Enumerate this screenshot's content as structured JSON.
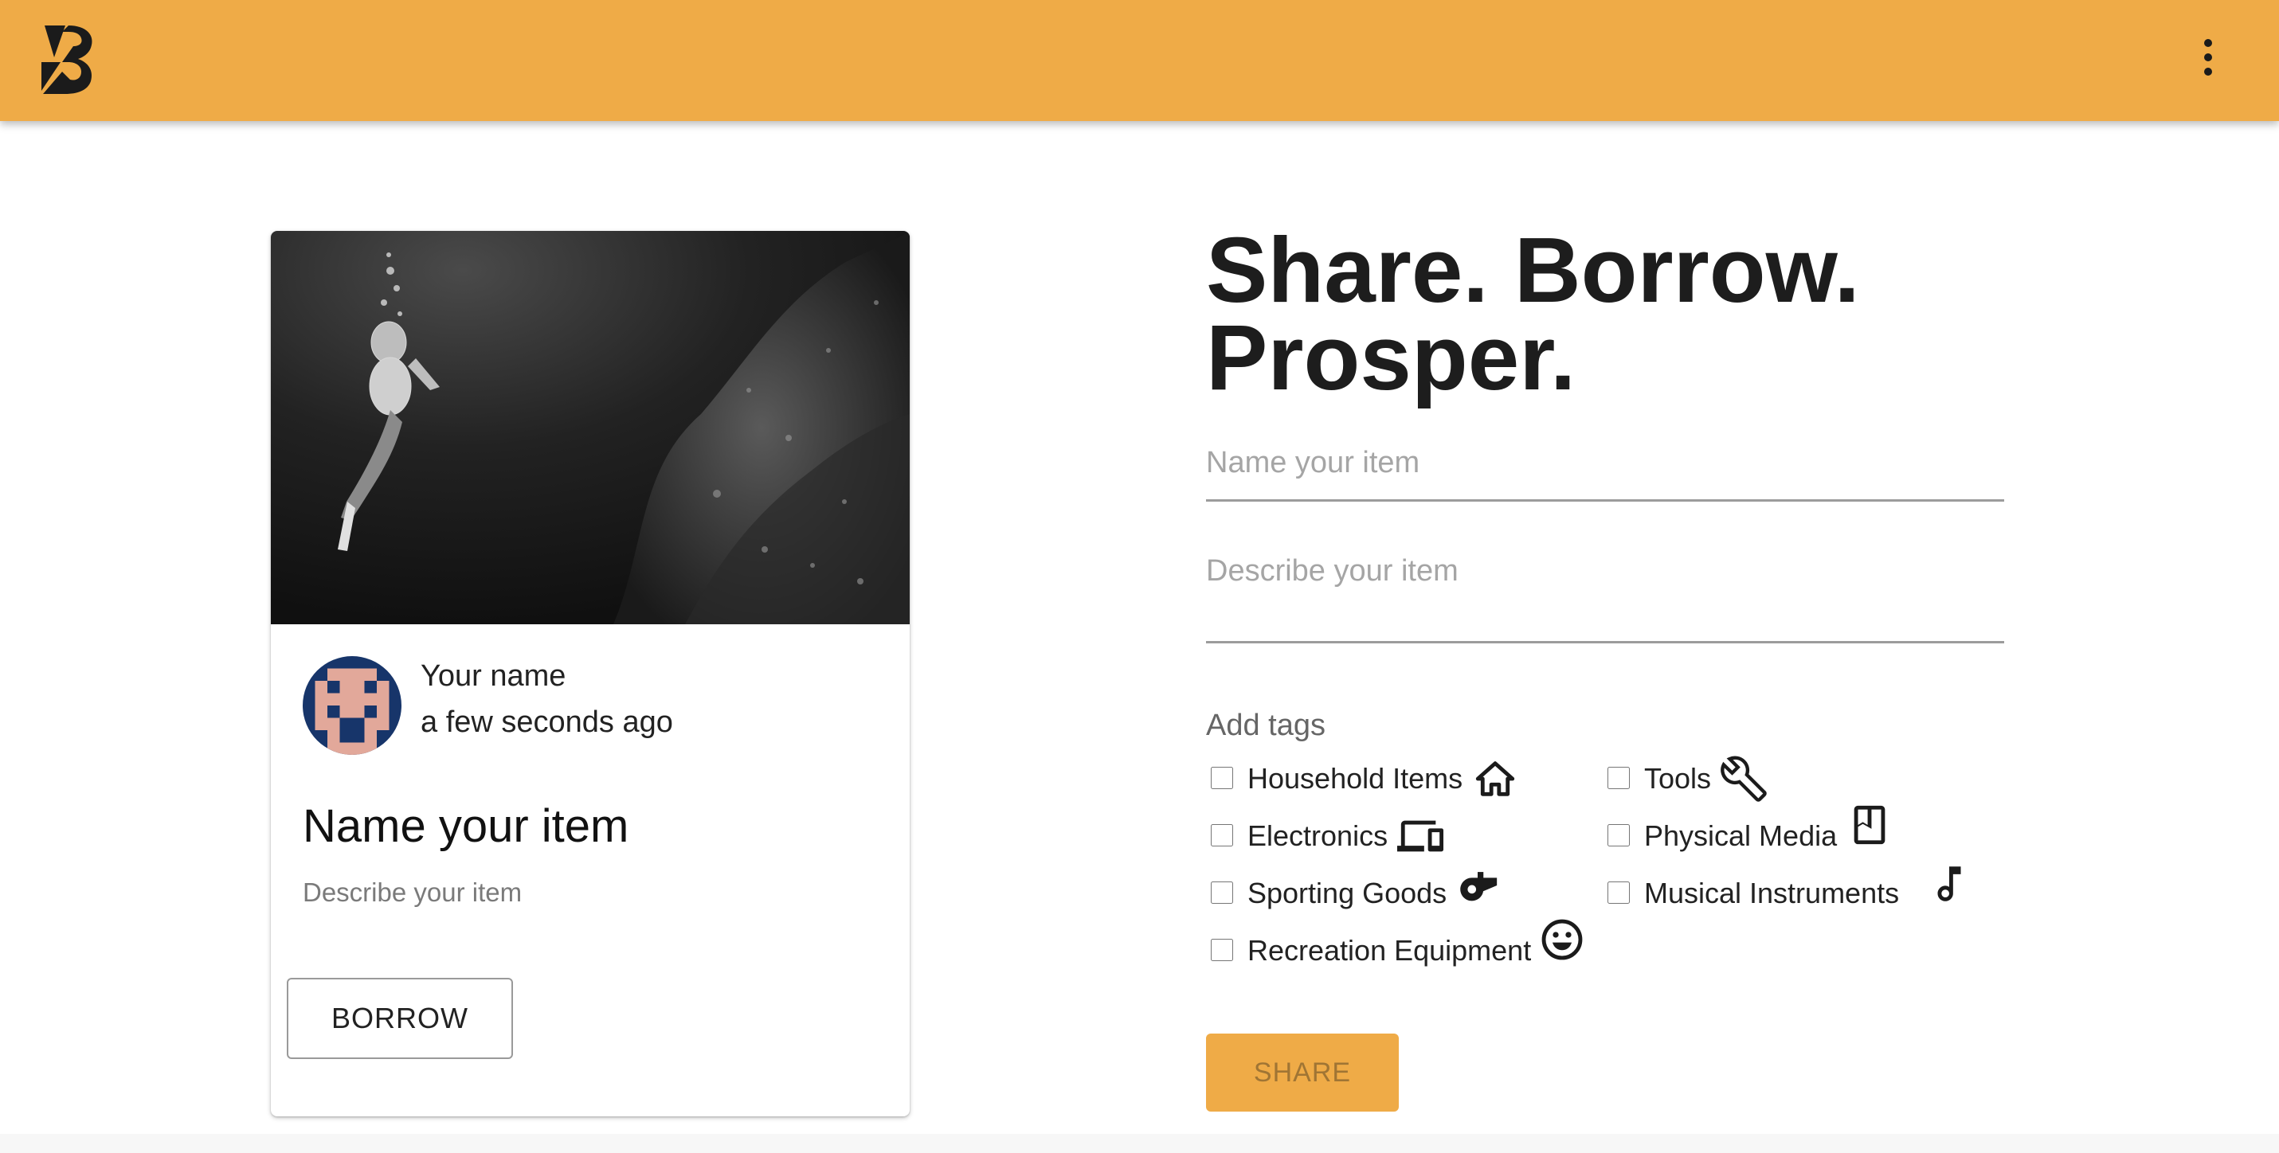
{
  "appbar": {
    "color": "#efab47",
    "logo_icon": "boomtown-logo-icon",
    "menu_icon": "more-vert-icon"
  },
  "card": {
    "image": "scuba-diver-photo",
    "owner_name": "Your name",
    "timestamp": "a few seconds ago",
    "title": "Name your item",
    "description": "Describe your item",
    "borrow_label": "BORROW"
  },
  "form": {
    "headline_line1": "Share. Borrow.",
    "headline_line2": "Prosper.",
    "name_placeholder": "Name your item",
    "description_placeholder": "Describe your item",
    "tags_label": "Add tags",
    "tags": [
      {
        "label": "Household Items",
        "icon": "home-icon",
        "checked": false
      },
      {
        "label": "Tools",
        "icon": "wrench-icon",
        "checked": false
      },
      {
        "label": "Electronics",
        "icon": "devices-icon",
        "checked": false
      },
      {
        "label": "Physical Media",
        "icon": "book-icon",
        "checked": false
      },
      {
        "label": "Sporting Goods",
        "icon": "whistle-icon",
        "checked": false
      },
      {
        "label": "Musical Instruments",
        "icon": "music-note-icon",
        "checked": false
      },
      {
        "label": "Recreation Equipment",
        "icon": "smiley-icon",
        "checked": false
      }
    ],
    "share_label": "SHARE"
  }
}
